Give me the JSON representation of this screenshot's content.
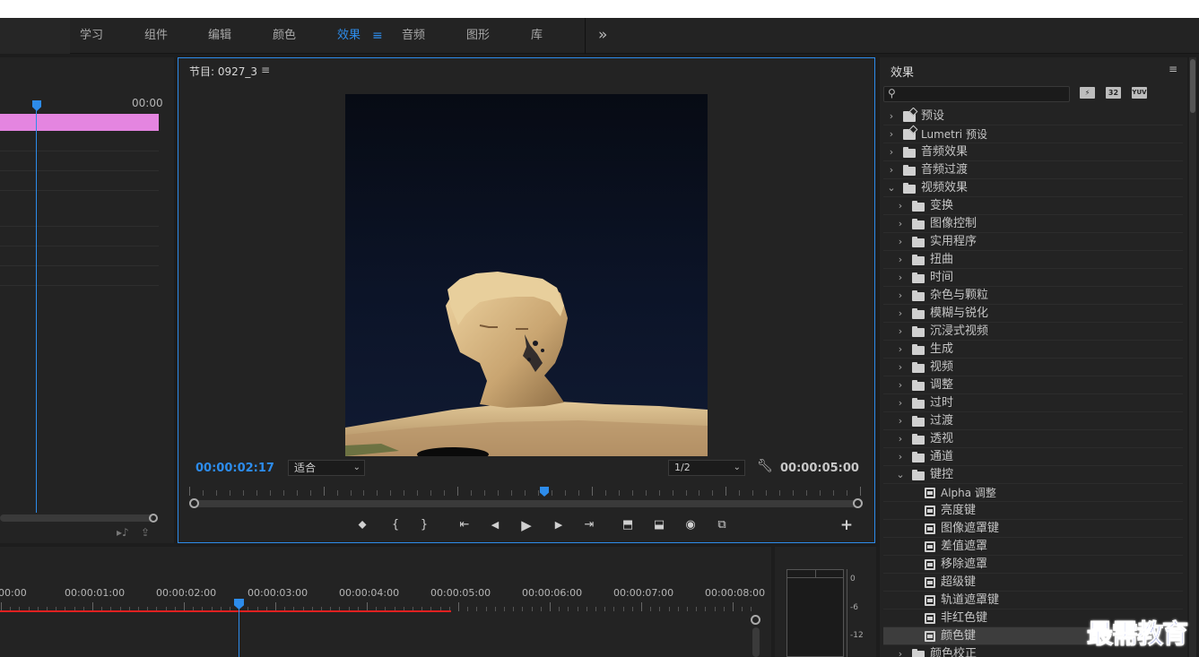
{
  "workspace": {
    "tabs": [
      {
        "label": "学习",
        "active": false
      },
      {
        "label": "组件",
        "active": false
      },
      {
        "label": "编辑",
        "active": false
      },
      {
        "label": "颜色",
        "active": false
      },
      {
        "label": "效果",
        "active": true
      },
      {
        "label": "音频",
        "active": false
      },
      {
        "label": "图形",
        "active": false
      },
      {
        "label": "库",
        "active": false
      }
    ],
    "menu_icon": "≡",
    "more_icon": "»"
  },
  "source": {
    "time": "00:00"
  },
  "program": {
    "title": "节目: 0927_3",
    "menu_icon": "≡",
    "current_time": "00:00:02:17",
    "fit": "适合",
    "resolution": "1/2",
    "duration": "00:00:05:00",
    "playhead_fraction": 0.53,
    "controls": [
      {
        "name": "add-marker-button",
        "glyph": "⬥"
      },
      {
        "name": "mark-in-button",
        "glyph": "{"
      },
      {
        "name": "mark-out-button",
        "glyph": "}"
      },
      {
        "name": "go-to-in-button",
        "glyph": "⇤"
      },
      {
        "name": "step-back-button",
        "glyph": "◀"
      },
      {
        "name": "play-button",
        "glyph": "▶"
      },
      {
        "name": "step-forward-button",
        "glyph": "▶"
      },
      {
        "name": "go-to-out-button",
        "glyph": "⇥"
      },
      {
        "name": "lift-button",
        "glyph": "⬒"
      },
      {
        "name": "extract-button",
        "glyph": "⬓"
      },
      {
        "name": "export-frame-button",
        "glyph": "◉"
      },
      {
        "name": "compare-view-button",
        "glyph": "⧉"
      }
    ],
    "add_button": "+"
  },
  "effects": {
    "title": "效果",
    "menu_icon": "≡",
    "search": {
      "value": "",
      "placeholder": ""
    },
    "filter_buttons": [
      "⚡",
      "32",
      "YUV"
    ],
    "tree": [
      {
        "label": "预设",
        "level": 0,
        "type": "preset",
        "expanded": false
      },
      {
        "label": "Lumetri 预设",
        "level": 0,
        "type": "preset",
        "expanded": false
      },
      {
        "label": "音频效果",
        "level": 0,
        "type": "folder",
        "expanded": false
      },
      {
        "label": "音频过渡",
        "level": 0,
        "type": "folder",
        "expanded": false
      },
      {
        "label": "视频效果",
        "level": 0,
        "type": "folder",
        "expanded": true
      },
      {
        "label": "变换",
        "level": 1,
        "type": "folder",
        "expanded": false
      },
      {
        "label": "图像控制",
        "level": 1,
        "type": "folder",
        "expanded": false
      },
      {
        "label": "实用程序",
        "level": 1,
        "type": "folder",
        "expanded": false
      },
      {
        "label": "扭曲",
        "level": 1,
        "type": "folder",
        "expanded": false
      },
      {
        "label": "时间",
        "level": 1,
        "type": "folder",
        "expanded": false
      },
      {
        "label": "杂色与颗粒",
        "level": 1,
        "type": "folder",
        "expanded": false
      },
      {
        "label": "模糊与锐化",
        "level": 1,
        "type": "folder",
        "expanded": false
      },
      {
        "label": "沉浸式视频",
        "level": 1,
        "type": "folder",
        "expanded": false
      },
      {
        "label": "生成",
        "level": 1,
        "type": "folder",
        "expanded": false
      },
      {
        "label": "视频",
        "level": 1,
        "type": "folder",
        "expanded": false
      },
      {
        "label": "调整",
        "level": 1,
        "type": "folder",
        "expanded": false
      },
      {
        "label": "过时",
        "level": 1,
        "type": "folder",
        "expanded": false
      },
      {
        "label": "过渡",
        "level": 1,
        "type": "folder",
        "expanded": false
      },
      {
        "label": "透视",
        "level": 1,
        "type": "folder",
        "expanded": false
      },
      {
        "label": "通道",
        "level": 1,
        "type": "folder",
        "expanded": false
      },
      {
        "label": "键控",
        "level": 1,
        "type": "folder",
        "expanded": true
      },
      {
        "label": "Alpha 调整",
        "level": 2,
        "type": "effect"
      },
      {
        "label": "亮度键",
        "level": 2,
        "type": "effect"
      },
      {
        "label": "图像遮罩键",
        "level": 2,
        "type": "effect"
      },
      {
        "label": "差值遮罩",
        "level": 2,
        "type": "effect"
      },
      {
        "label": "移除遮罩",
        "level": 2,
        "type": "effect"
      },
      {
        "label": "超级键",
        "level": 2,
        "type": "effect"
      },
      {
        "label": "轨道遮罩键",
        "level": 2,
        "type": "effect"
      },
      {
        "label": "非红色键",
        "level": 2,
        "type": "effect"
      },
      {
        "label": "颜色键",
        "level": 2,
        "type": "effect",
        "selected": true
      },
      {
        "label": "颜色校正",
        "level": 1,
        "type": "folder",
        "expanded": false
      }
    ]
  },
  "timeline": {
    "labels": [
      "00:00",
      "00:00:01:00",
      "00:00:02:00",
      "00:00:03:00",
      "00:00:04:00",
      "00:00:05:00",
      "00:00:06:00",
      "00:00:07:00",
      "00:00:08:00"
    ]
  },
  "meter": {
    "labels": [
      "0",
      "-6",
      "-12"
    ]
  },
  "watermark": "最需教育",
  "colors": {
    "accent": "#2d8ceb",
    "clip": "#e485e0",
    "work_area": "#e02020"
  }
}
